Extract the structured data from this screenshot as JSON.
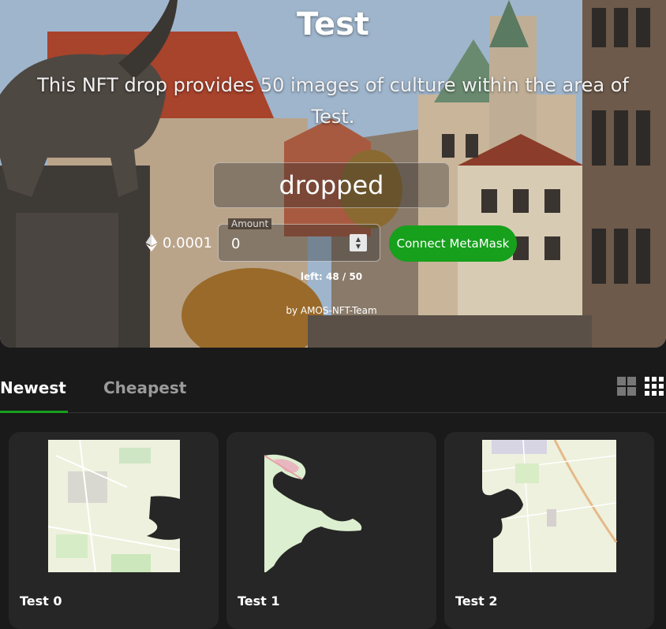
{
  "hero": {
    "title": "Test",
    "description": "This NFT drop provides 50 images of culture within the area of Test.",
    "status": "dropped",
    "price": "0.0001",
    "amount": {
      "label": "Amount",
      "value": "0"
    },
    "connect_button": "Connect MetaMask",
    "left_count": "left: 48 / 50",
    "by_team": "by AMOS-NFT-Team"
  },
  "tabs": [
    {
      "label": "Newest",
      "active": true
    },
    {
      "label": "Cheapest",
      "active": false
    }
  ],
  "view_toggles": [
    "grid-large-icon",
    "grid-small-icon"
  ],
  "cards": [
    {
      "title": "Test 0"
    },
    {
      "title": "Test 1"
    },
    {
      "title": "Test 2"
    }
  ],
  "colors": {
    "accent": "#16a01c",
    "background": "#1a1a1a",
    "card": "#262626",
    "map_fill": "#eef1dd"
  }
}
